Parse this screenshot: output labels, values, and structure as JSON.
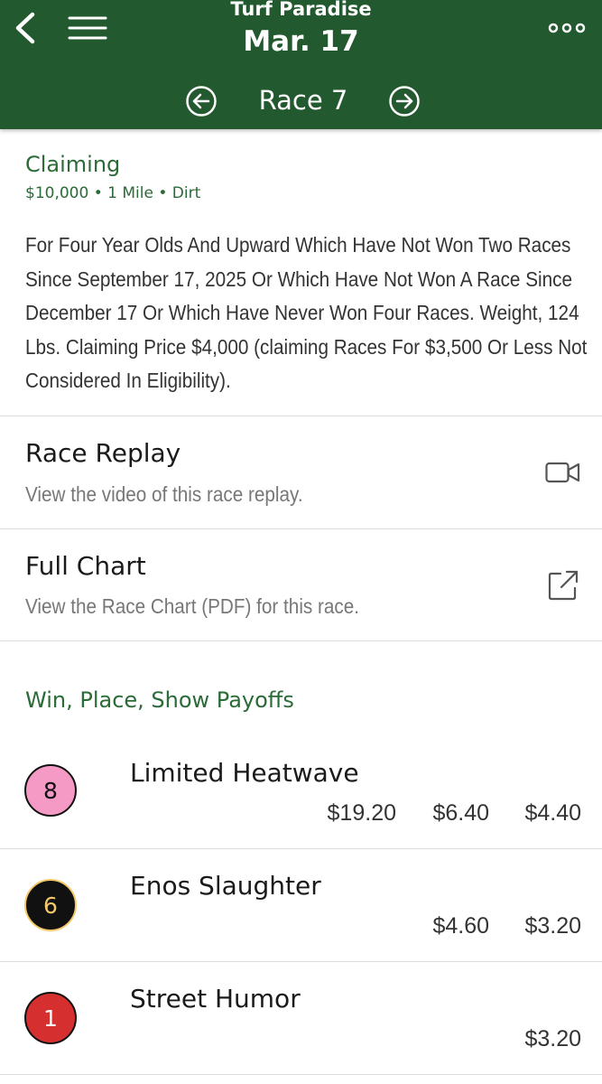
{
  "header": {
    "venue": "Turf Paradise",
    "date": "Mar. 17",
    "race_label": "Race 7",
    "background_color": "#22592e"
  },
  "race": {
    "type": "Claiming",
    "meta": "$10,000 • 1 Mile • Dirt",
    "conditions": "For Four Year Olds And Upward Which Have Not Won Two Races Since September 17, 2025 Or Which Have Not Won A Race Since December 17 Or Which Have Never Won Four Races. Weight, 124 Lbs. Claiming Price $4,000 (claiming Races For $3,500 Or Less Not Considered In Eligibility)."
  },
  "replay": {
    "title": "Race Replay",
    "subtitle": "View the video of this race replay.",
    "icon": "video-camera-icon"
  },
  "chart": {
    "title": "Full Chart",
    "subtitle": "View the Race Chart (PDF) for this race.",
    "icon": "external-link-icon"
  },
  "payoffs": {
    "title": "Win, Place, Show Payoffs",
    "entries": [
      {
        "number": "8",
        "name": "Limited Heatwave",
        "win": "$19.20",
        "place": "$6.40",
        "show": "$4.40",
        "badge_color": "#f49ac4",
        "badge_text_color": "#111111"
      },
      {
        "number": "6",
        "name": "Enos Slaughter",
        "win": "",
        "place": "$4.60",
        "show": "$3.20",
        "badge_color": "#111111",
        "badge_text_color": "#f5c96a"
      },
      {
        "number": "1",
        "name": "Street Humor",
        "win": "",
        "place": "",
        "show": "$3.20",
        "badge_color": "#d62f2f",
        "badge_text_color": "#ffffff"
      }
    ]
  }
}
